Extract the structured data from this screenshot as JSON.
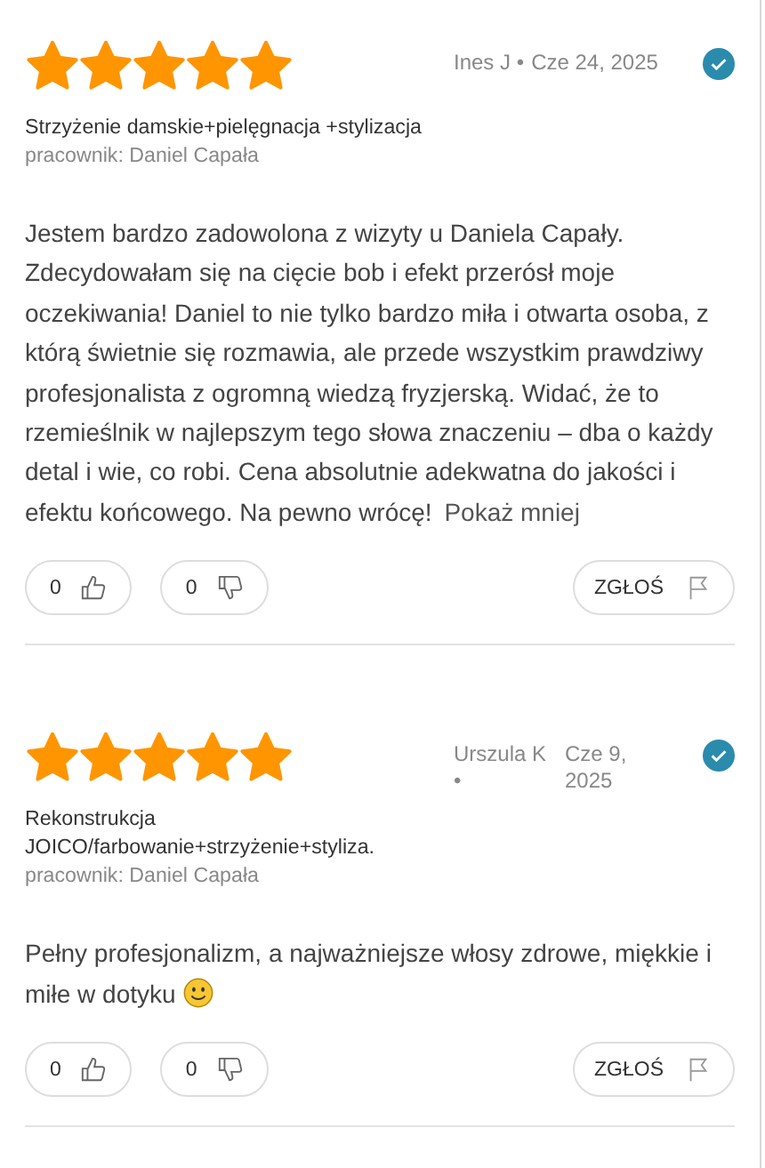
{
  "reviews": [
    {
      "stars": 5,
      "author": "Ines J",
      "separator": "•",
      "date": "Cze 24, 2025",
      "verified": true,
      "service": "Strzyżenie damskie+pielęgnacja +stylizacja",
      "employee": "pracownik: Daniel Capała",
      "text": "Jestem bardzo zadowolona z wizyty u Daniela Capały. Zdecydowałam się na cięcie bob i efekt przerósł moje oczekiwania! Daniel to nie tylko bardzo miła i otwarta osoba, z którą świetnie się rozmawia, ale przede wszystkim prawdziwy profesjonalista z ogromną wiedzą fryzjerską. Widać, że to rzemieślnik w najlepszym tego słowa znaczeniu – dba o każdy detal i wie, co robi. Cena absolutnie adekwatna do jakości i efektu końcowego. Na pewno wrócę! ",
      "toggle": "Pokaż mniej",
      "likes": "0",
      "dislikes": "0",
      "report": "ZGŁOŚ"
    },
    {
      "stars": 5,
      "author": "Urszula K",
      "separator": "•",
      "date": "Cze 9, 2025",
      "verified": true,
      "service": "Rekonstrukcja JOICO/farbowanie+strzyżenie+styliza.",
      "employee": "pracownik: Daniel Capała",
      "text": "Pełny profesjonalizm, a najważniejsze włosy zdrowe, miękkie i miłe w dotyku ",
      "emoji": true,
      "likes": "0",
      "dislikes": "0",
      "report": "ZGŁOŚ"
    }
  ]
}
